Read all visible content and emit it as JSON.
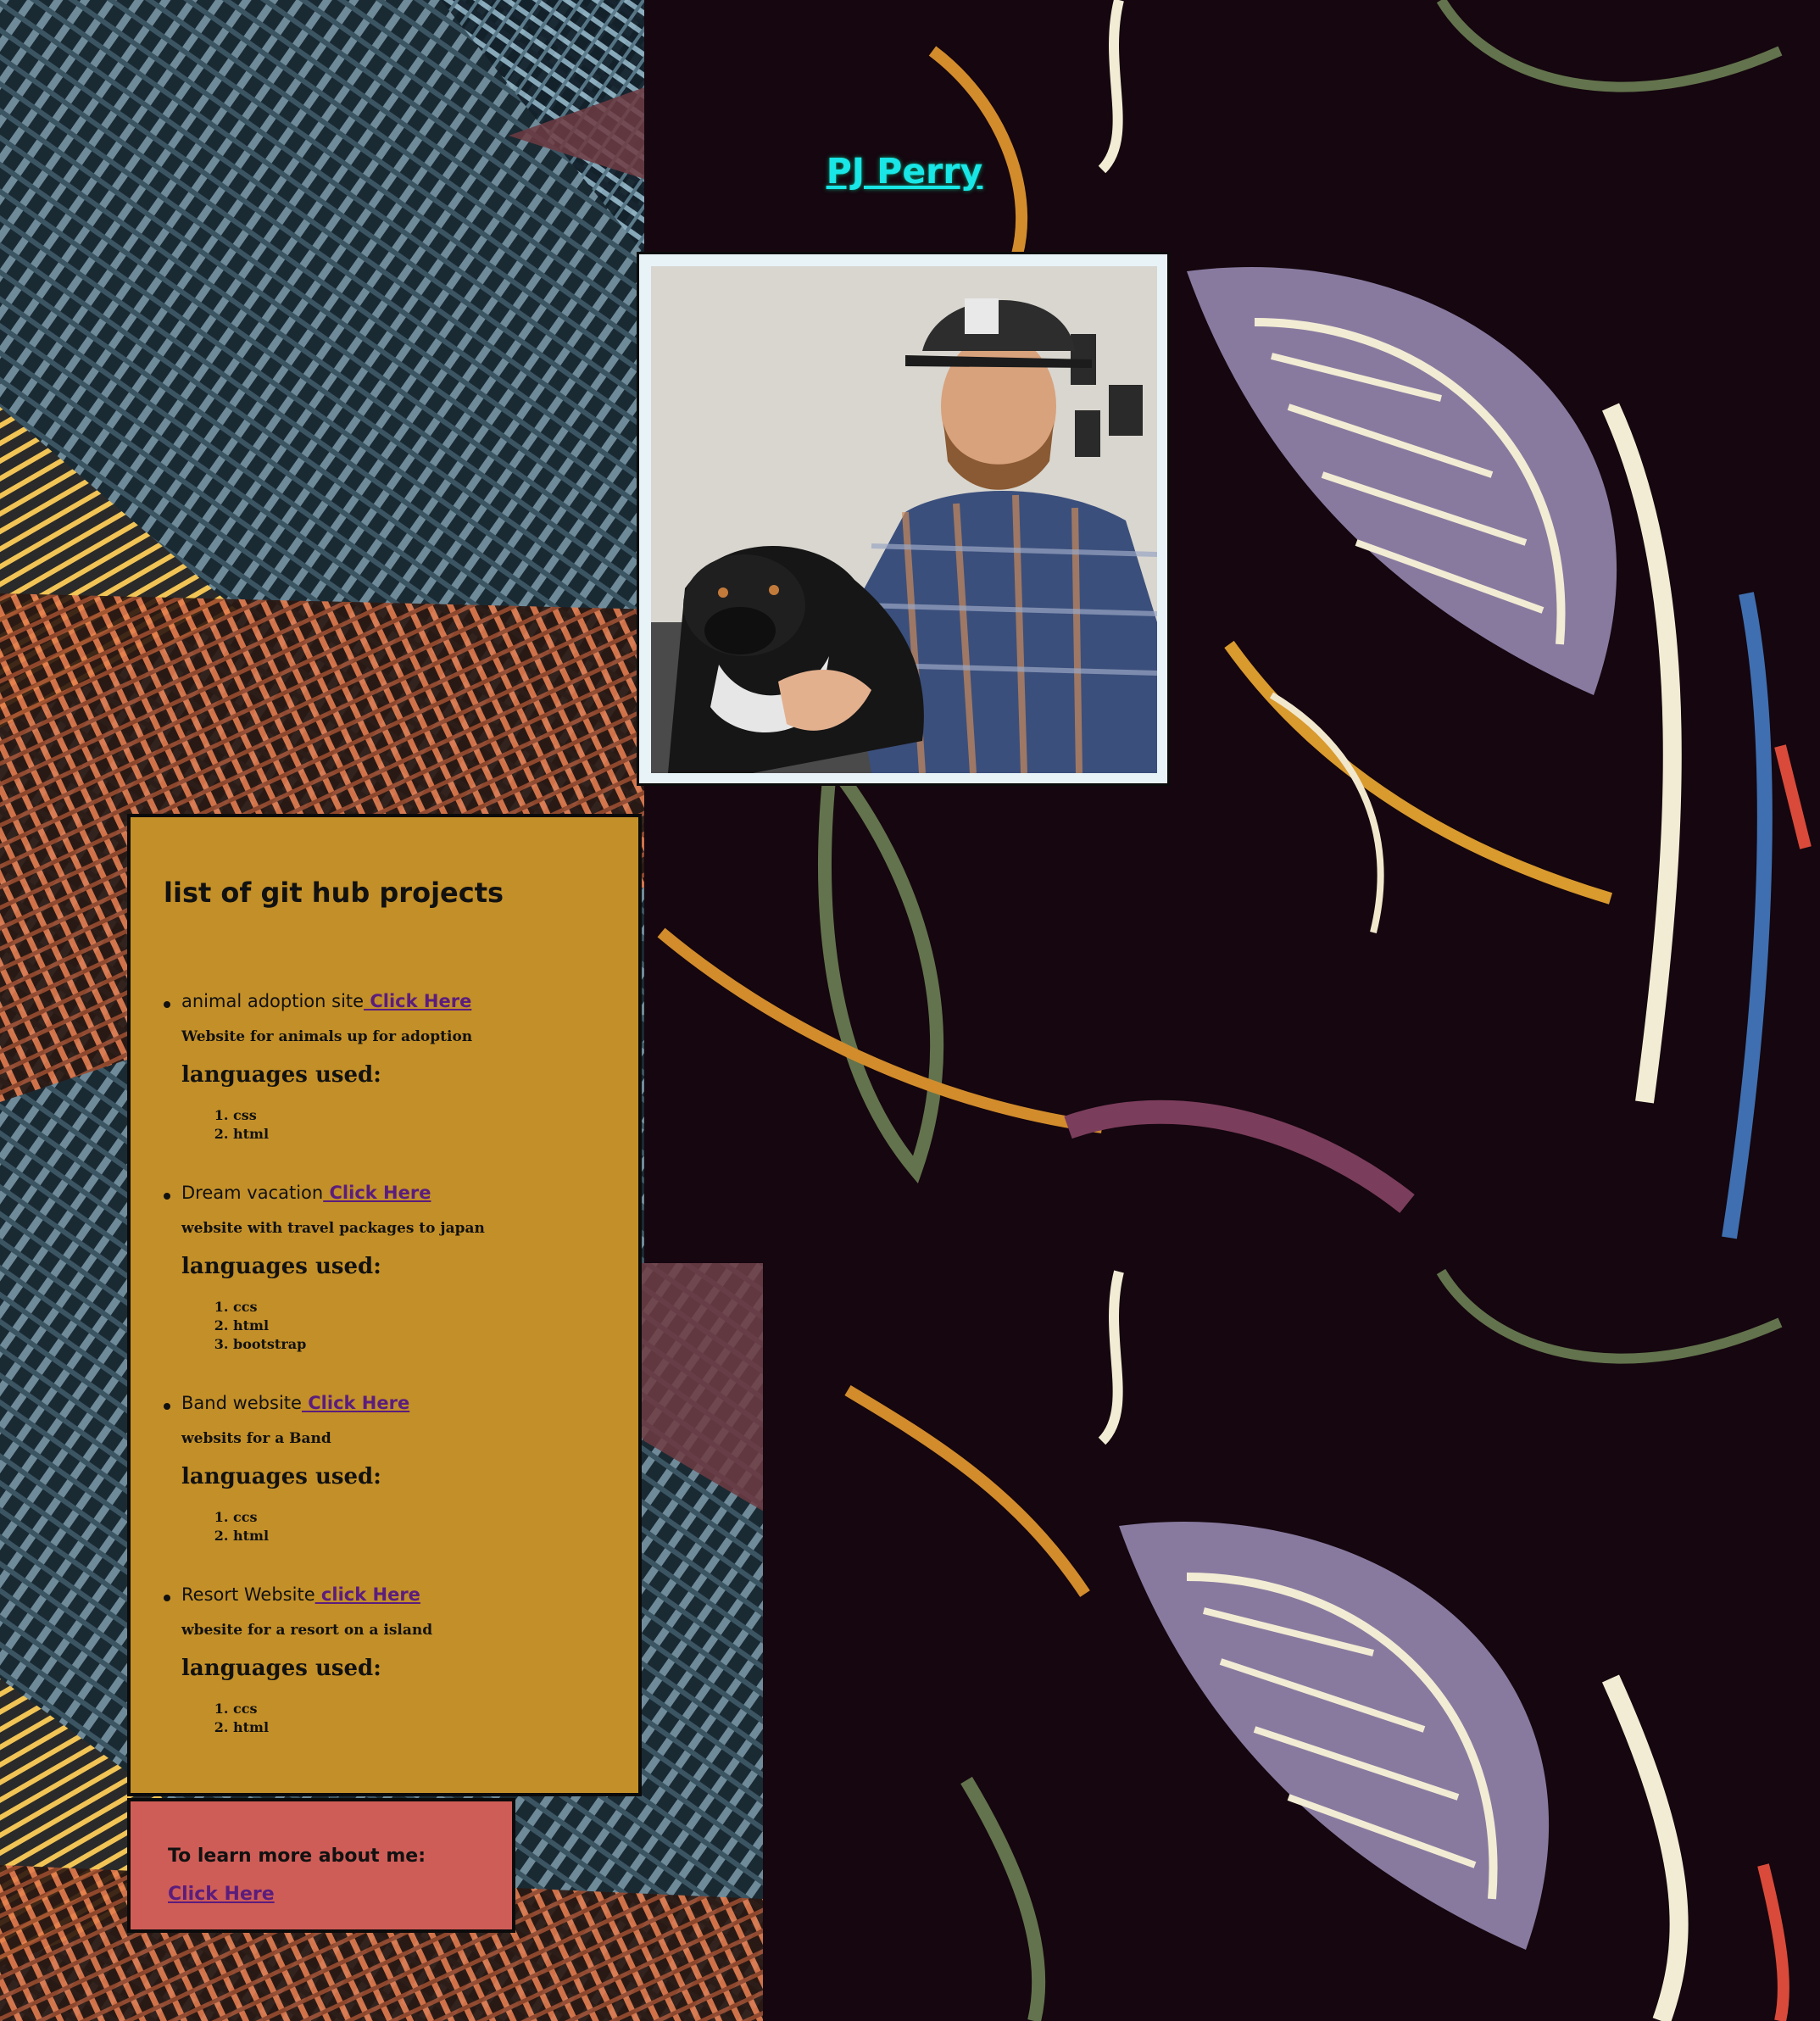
{
  "header": {
    "name": "PJ Perry"
  },
  "profile_photo": {
    "alt": "profile photo"
  },
  "projects_section": {
    "title": "list of git hub projects",
    "languages_heading": "languages used:",
    "items": [
      {
        "name": "animal adoption site",
        "link_label": " Click Here",
        "description": "Website for animals up for adoption",
        "languages": [
          "css",
          "html"
        ]
      },
      {
        "name": "Dream vacation",
        "link_label": " Click Here",
        "description": "website with travel packages to japan",
        "languages": [
          "ccs",
          "html",
          "bootstrap"
        ]
      },
      {
        "name": "Band website",
        "link_label": " Click Here",
        "description": "websits for a Band",
        "languages": [
          "ccs",
          "html"
        ]
      },
      {
        "name": "Resort Website",
        "link_label": " click Here",
        "description": "wbesite for a resort on a island",
        "languages": [
          "ccs",
          "html"
        ]
      }
    ]
  },
  "about": {
    "text": "To learn more about me:",
    "link_label": " Click Here"
  },
  "colors": {
    "name_link": "#19e6e6",
    "projects_bg": "#c38f28",
    "about_bg": "#cf5d57",
    "link": "#5b1d7c"
  }
}
